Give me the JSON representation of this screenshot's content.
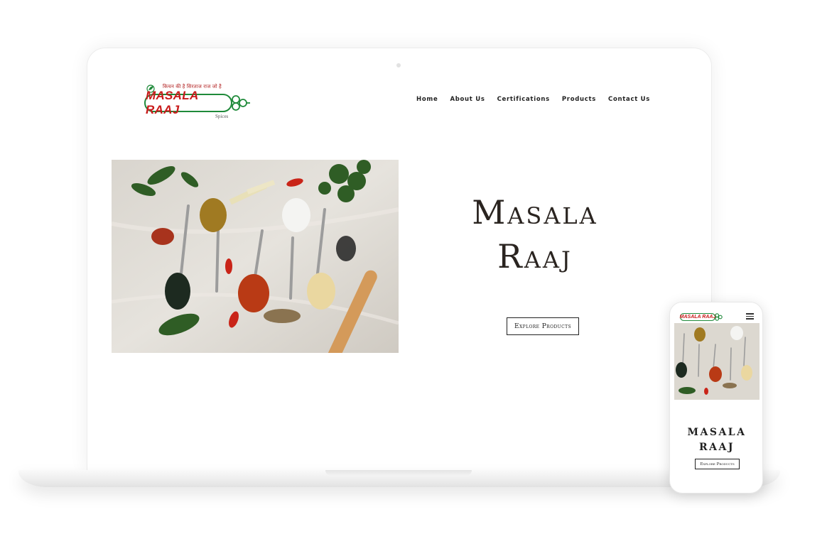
{
  "site": {
    "logo": {
      "tagline": "किचन की है सिरताज राज जो है",
      "name": "MASALA RAAJ",
      "sub": "Spices"
    },
    "nav": [
      "Home",
      "About Us",
      "Certifications",
      "Products",
      "Contact Us"
    ],
    "hero": {
      "title_line1": "Masala",
      "title_line2": "Raaj",
      "button": "Explore Products",
      "image_icon": "spices-spoons-photo"
    }
  },
  "mobile": {
    "logo_name": "MASALA RAAJ",
    "menu_icon": "hamburger-icon",
    "title_line1": "MASALA",
    "title_line2": "RAAJ",
    "button": "Explore Products"
  },
  "colors": {
    "brand_red": "#c81a1a",
    "brand_green": "#1f8a3a",
    "text_dark": "#2a2420"
  }
}
